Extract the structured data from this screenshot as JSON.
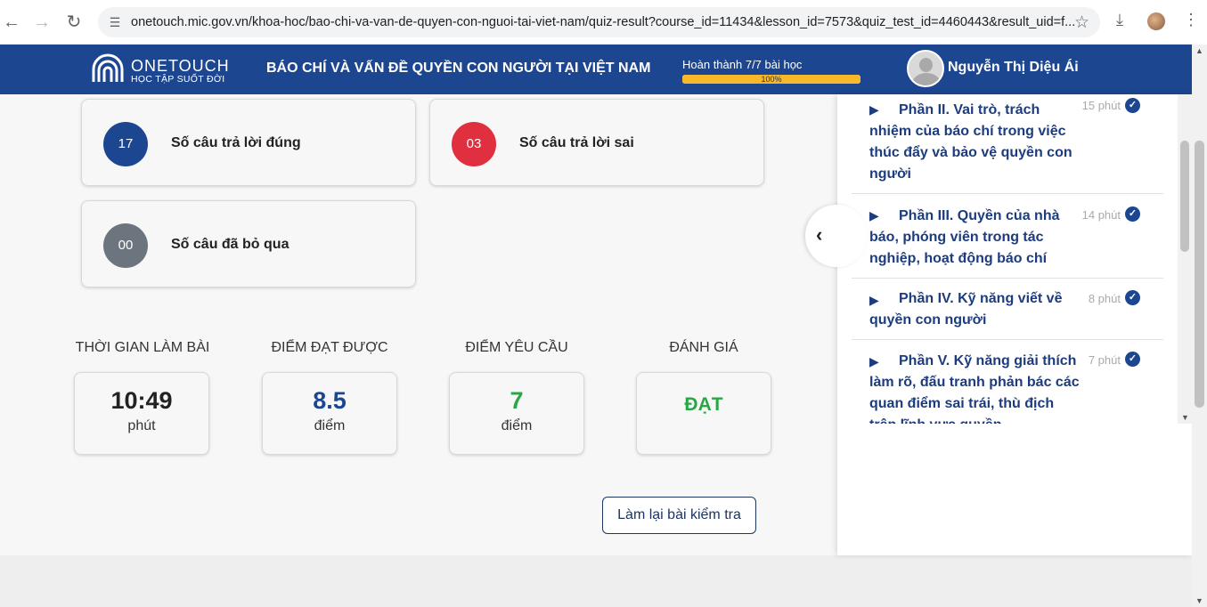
{
  "browser": {
    "url": "onetouch.mic.gov.vn/khoa-hoc/bao-chi-va-van-de-quyen-con-nguoi-tai-viet-nam/quiz-result?course_id=11434&lesson_id=7573&quiz_test_id=4460443&result_uid=f..."
  },
  "header": {
    "logo_text": "ONETOUCH",
    "logo_sub": "HỌC TẬP SUỐT ĐỜI",
    "course_title": "BÁO CHÍ VÀ VẤN ĐỀ QUYỀN CON NGƯỜI TẠI VIỆT NAM",
    "progress_label": "Hoàn thành 7/7 bài học",
    "progress_percent": 100,
    "progress_text": "100%",
    "user_name": "Nguyễn Thị Diệu Ái"
  },
  "stats": {
    "correct_value": "17",
    "correct_label": "Số câu trả lời đúng",
    "wrong_value": "03",
    "wrong_label": "Số câu trả lời sai",
    "skipped_value": "00",
    "skipped_label": "Số câu đã bỏ qua"
  },
  "metrics": {
    "time_head": "THỜI GIAN LÀM BÀI",
    "time_value": "10:49",
    "time_unit": "phút",
    "score_head": "ĐIỂM ĐẠT ĐƯỢC",
    "score_value": "8.5",
    "score_unit": "điểm",
    "required_head": "ĐIỂM YÊU CẦU",
    "required_value": "7",
    "required_unit": "điểm",
    "result_head": "ĐÁNH GIÁ",
    "result_value": "ĐẠT"
  },
  "retry_label": "Làm lại bài kiểm tra",
  "lessons": [
    {
      "title": "Phần II. Vai trò, trách nhiệm của báo chí trong việc thúc đẩy và bảo vệ quyền con người",
      "duration": "15 phút"
    },
    {
      "title": "Phần III. Quyền của nhà báo, phóng viên trong tác nghiệp, hoạt động báo chí",
      "duration": "14 phút"
    },
    {
      "title": "Phần IV. Kỹ năng viết về quyền con người",
      "duration": "8 phút"
    },
    {
      "title": "Phần V. Kỹ năng giải thích làm rõ, đấu tranh phản bác các quan điểm sai trái, thù địch trên lĩnh vực quyền",
      "duration": "7 phút"
    }
  ],
  "colors": {
    "brand": "#1d4690",
    "correct": "#1d4690",
    "wrong": "#e02f3e",
    "skipped": "#6c757d",
    "pass": "#28a745",
    "progress": "#f7b928"
  }
}
